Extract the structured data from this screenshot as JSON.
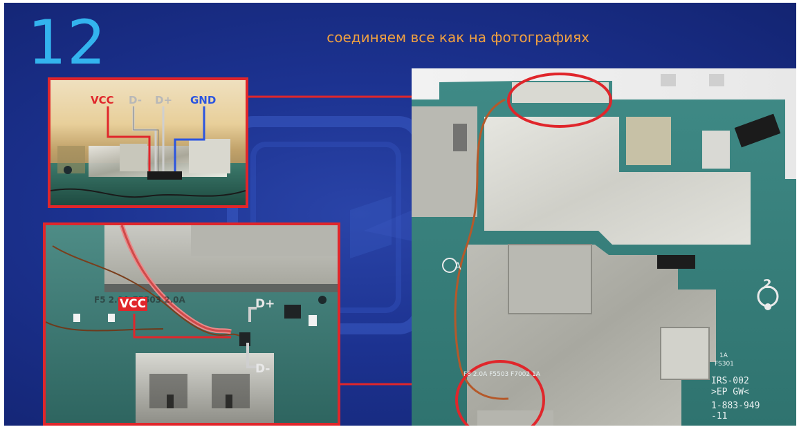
{
  "slide": {
    "number": "12",
    "caption": "соединяем все как на фотографиях"
  },
  "top_closeup": {
    "labels": {
      "vcc": "VCC",
      "dminus": "D-",
      "dplus": "D+",
      "gnd": "GND"
    }
  },
  "bottom_closeup": {
    "labels": {
      "vcc": "VCC",
      "dplus": "D+",
      "dminus": "D-"
    },
    "silkscreen": "F5  2.0A   F5503 2.0A"
  },
  "board": {
    "silkscreen_lines": [
      "1A",
      "FS301",
      "IRS-002",
      ">EP GW<",
      "1-883-949",
      "-11"
    ],
    "marks": [
      "A",
      "2"
    ],
    "lower_text": "F8 2.0A   F5503   F7002 1A"
  },
  "colors": {
    "vcc": "#e0262b",
    "d_lines": "#c8c8c8",
    "gnd": "#2b55e0",
    "accent_number": "#33b4ee",
    "caption": "#f0a040",
    "highlight": "#e0262b"
  }
}
